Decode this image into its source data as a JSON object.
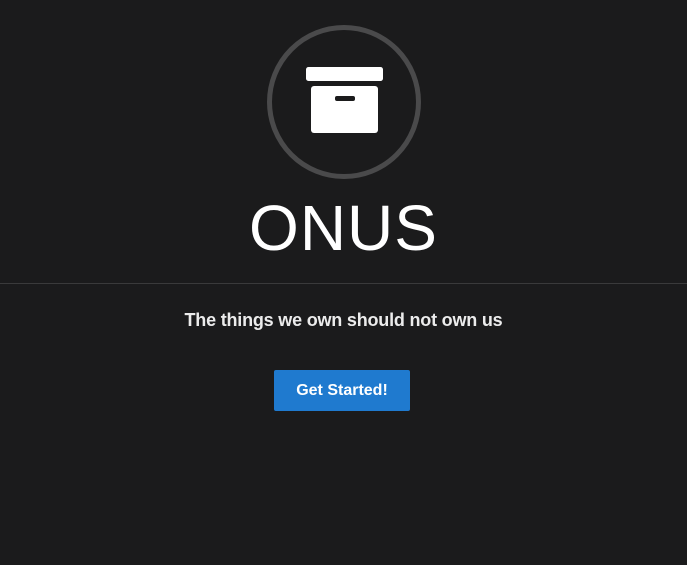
{
  "brand": {
    "title": "ONUS",
    "tagline": "The things we own should not own us",
    "logo_icon": "archive-box-icon"
  },
  "cta": {
    "label": "Get Started!"
  },
  "colors": {
    "background": "#1b1b1c",
    "logo_ring": "#4a4a4b",
    "text": "#ffffff",
    "accent": "#1f7acf"
  }
}
